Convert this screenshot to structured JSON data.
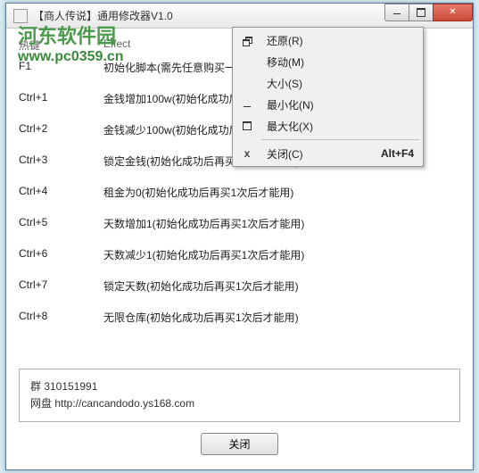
{
  "watermark": {
    "brand": "河东软件园",
    "url": "www.pc0359.cn"
  },
  "window": {
    "title": "【商人传说】通用修改器V1.0",
    "controls": {
      "min": "–",
      "max": "□",
      "close": "✕"
    }
  },
  "headers": {
    "hotkey": "热键",
    "effect": "Effect"
  },
  "rows": [
    {
      "hotkey": "F1",
      "effect": "初始化脚本(需先任意购买一"
    },
    {
      "hotkey": "Ctrl+1",
      "effect": "金钱增加100w(初始化成功后"
    },
    {
      "hotkey": "Ctrl+2",
      "effect": "金钱减少100w(初始化成功后再买1次后才能用)"
    },
    {
      "hotkey": "Ctrl+3",
      "effect": "锁定金钱(初始化成功后再买1次后才能用)"
    },
    {
      "hotkey": "Ctrl+4",
      "effect": "租金为0(初始化成功后再买1次后才能用)"
    },
    {
      "hotkey": "Ctrl+5",
      "effect": "天数增加1(初始化成功后再买1次后才能用)"
    },
    {
      "hotkey": "Ctrl+6",
      "effect": "天数减少1(初始化成功后再买1次后才能用)"
    },
    {
      "hotkey": "Ctrl+7",
      "effect": "锁定天数(初始化成功后再买1次后才能用)"
    },
    {
      "hotkey": "Ctrl+8",
      "effect": "无限仓库(初始化成功后再买1次后才能用)"
    }
  ],
  "info": {
    "line1": "群 310151991",
    "line2": "网盘 http://cancandodo.ys168.com"
  },
  "footer": {
    "close": "关闭"
  },
  "menu": {
    "items": [
      {
        "label": "还原(R)",
        "icon": "restore"
      },
      {
        "label": "移动(M)",
        "icon": ""
      },
      {
        "label": "大小(S)",
        "icon": ""
      },
      {
        "label": "最小化(N)",
        "icon": "min"
      },
      {
        "label": "最大化(X)",
        "icon": "max"
      }
    ],
    "close": {
      "label": "关闭(C)",
      "shortcut": "Alt+F4",
      "icon": "x"
    }
  }
}
